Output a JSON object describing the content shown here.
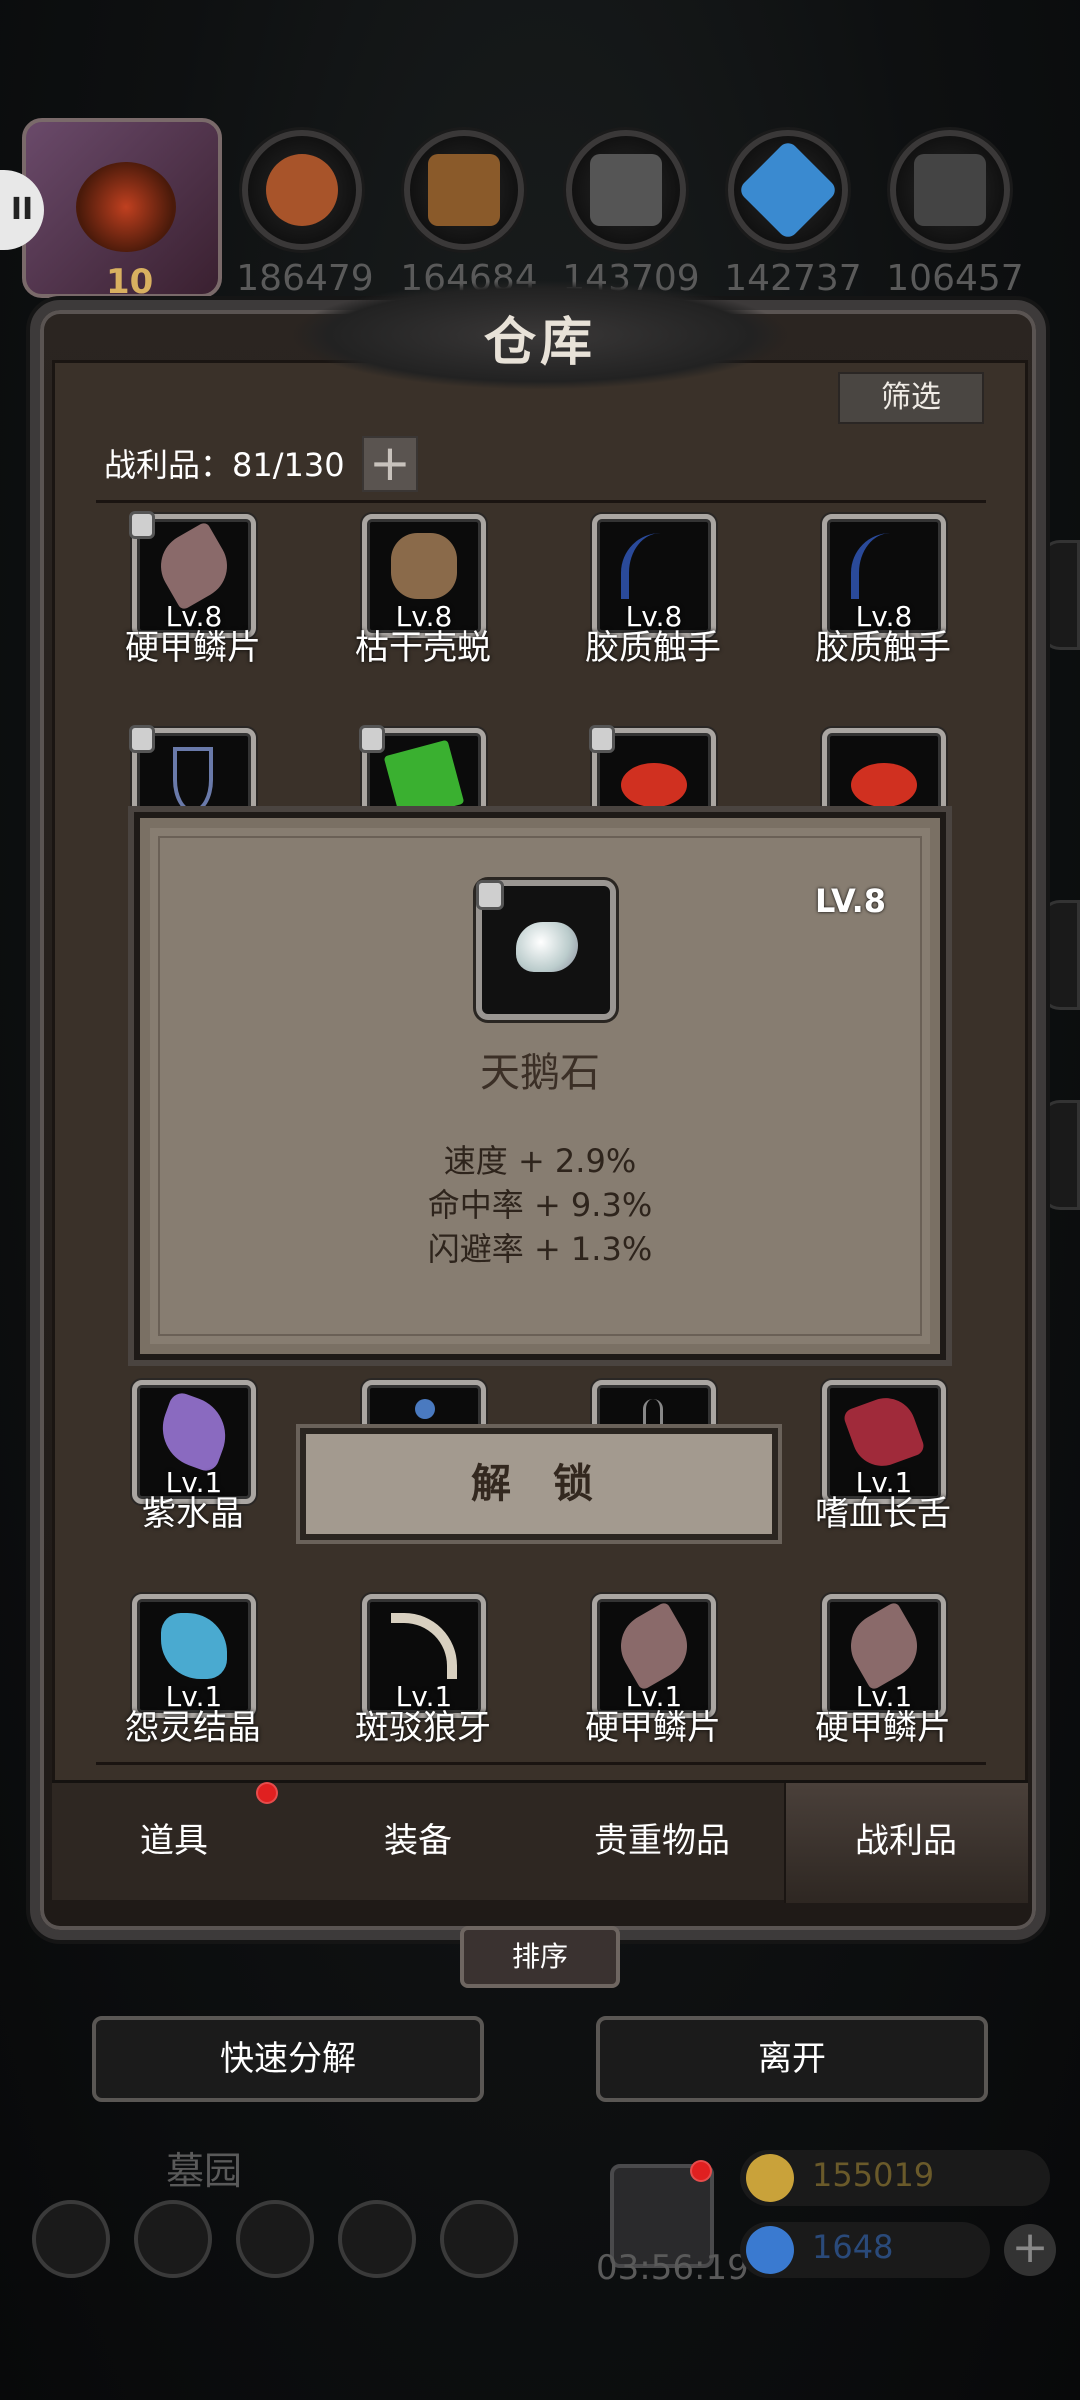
{
  "top_bar": {
    "avatar_level": "10",
    "resources": [
      {
        "icon": "meat-icon",
        "value": "186479",
        "color": "#a8542a"
      },
      {
        "icon": "wood-icon",
        "value": "164684",
        "color": "#8a5a2a"
      },
      {
        "icon": "stone-icon",
        "value": "143709",
        "color": "#555555"
      },
      {
        "icon": "crystal-icon",
        "value": "142737",
        "color": "#3a8ad0"
      },
      {
        "icon": "iron-icon",
        "value": "106457",
        "color": "#444444"
      }
    ]
  },
  "panel": {
    "title": "仓库",
    "filter_label": "筛选",
    "count_label": "战利品：81/130",
    "plus_label": "+"
  },
  "items_row1": [
    {
      "level": "Lv.8",
      "name": "硬甲鳞片",
      "icon": "scale-icon",
      "color": "#8a6a6a",
      "locked": true
    },
    {
      "level": "Lv.8",
      "name": "枯干壳蜕",
      "icon": "shell-icon",
      "color": "#8a6a4a",
      "locked": false
    },
    {
      "level": "Lv.8",
      "name": "胶质触手",
      "icon": "tentacle-icon",
      "color": "#2a4a9a",
      "locked": false
    },
    {
      "level": "Lv.8",
      "name": "胶质触手",
      "icon": "tentacle-icon",
      "color": "#2a4a9a",
      "locked": false
    }
  ],
  "items_row2": [
    {
      "icon": "pendant-icon",
      "color": "#6a7aaa",
      "locked": true
    },
    {
      "icon": "green-gem-icon",
      "color": "#3ab030",
      "locked": true
    },
    {
      "icon": "red-stone-icon",
      "color": "#d03020",
      "locked": true
    },
    {
      "icon": "red-stone-icon",
      "color": "#d03020",
      "locked": false
    }
  ],
  "items_row3": [
    {
      "level": "Lv.1",
      "name": "紫水晶",
      "icon": "amethyst-icon",
      "color": "#8a6ac0"
    },
    {
      "level": "",
      "name": "",
      "icon": "blue-drop-icon",
      "color": "#4a7ac0"
    },
    {
      "level": "",
      "name": "",
      "icon": "claw-icon",
      "color": "#888888"
    },
    {
      "level": "Lv.1",
      "name": "嗜血长舌",
      "icon": "tongue-icon",
      "color": "#a02a3a"
    }
  ],
  "items_row4": [
    {
      "level": "Lv.1",
      "name": "怨灵结晶",
      "icon": "crystal-cluster-icon",
      "color": "#4aaad0"
    },
    {
      "level": "Lv.1",
      "name": "斑驳狼牙",
      "icon": "fang-icon",
      "color": "#d8d0c0"
    },
    {
      "level": "Lv.1",
      "name": "硬甲鳞片",
      "icon": "scale-icon",
      "color": "#8a6a6a"
    },
    {
      "level": "Lv.1",
      "name": "硬甲鳞片",
      "icon": "scale-icon",
      "color": "#8a6a6a"
    }
  ],
  "popup": {
    "level": "LV.8",
    "name": "天鹅石",
    "icon": "swan-stone-icon",
    "stats": [
      "速度 + 2.9%",
      "命中率 + 9.3%",
      "闪避率 + 1.3%"
    ],
    "unlock_label": "解 锁"
  },
  "tabs": [
    {
      "label": "道具",
      "has_badge": true
    },
    {
      "label": "装备",
      "has_badge": false
    },
    {
      "label": "贵重物品",
      "has_badge": false
    },
    {
      "label": "战利品",
      "has_badge": false,
      "active": true
    }
  ],
  "actions": {
    "sort_label": "排序",
    "quick_decompose_label": "快速分解",
    "leave_label": "离开"
  },
  "bottom_hud": {
    "zone_name": "墓园",
    "timer": "03:56:19",
    "gold": "155019",
    "gems": "1648",
    "gold_color": "#c9a23a",
    "gem_color": "#3a7ad0"
  }
}
